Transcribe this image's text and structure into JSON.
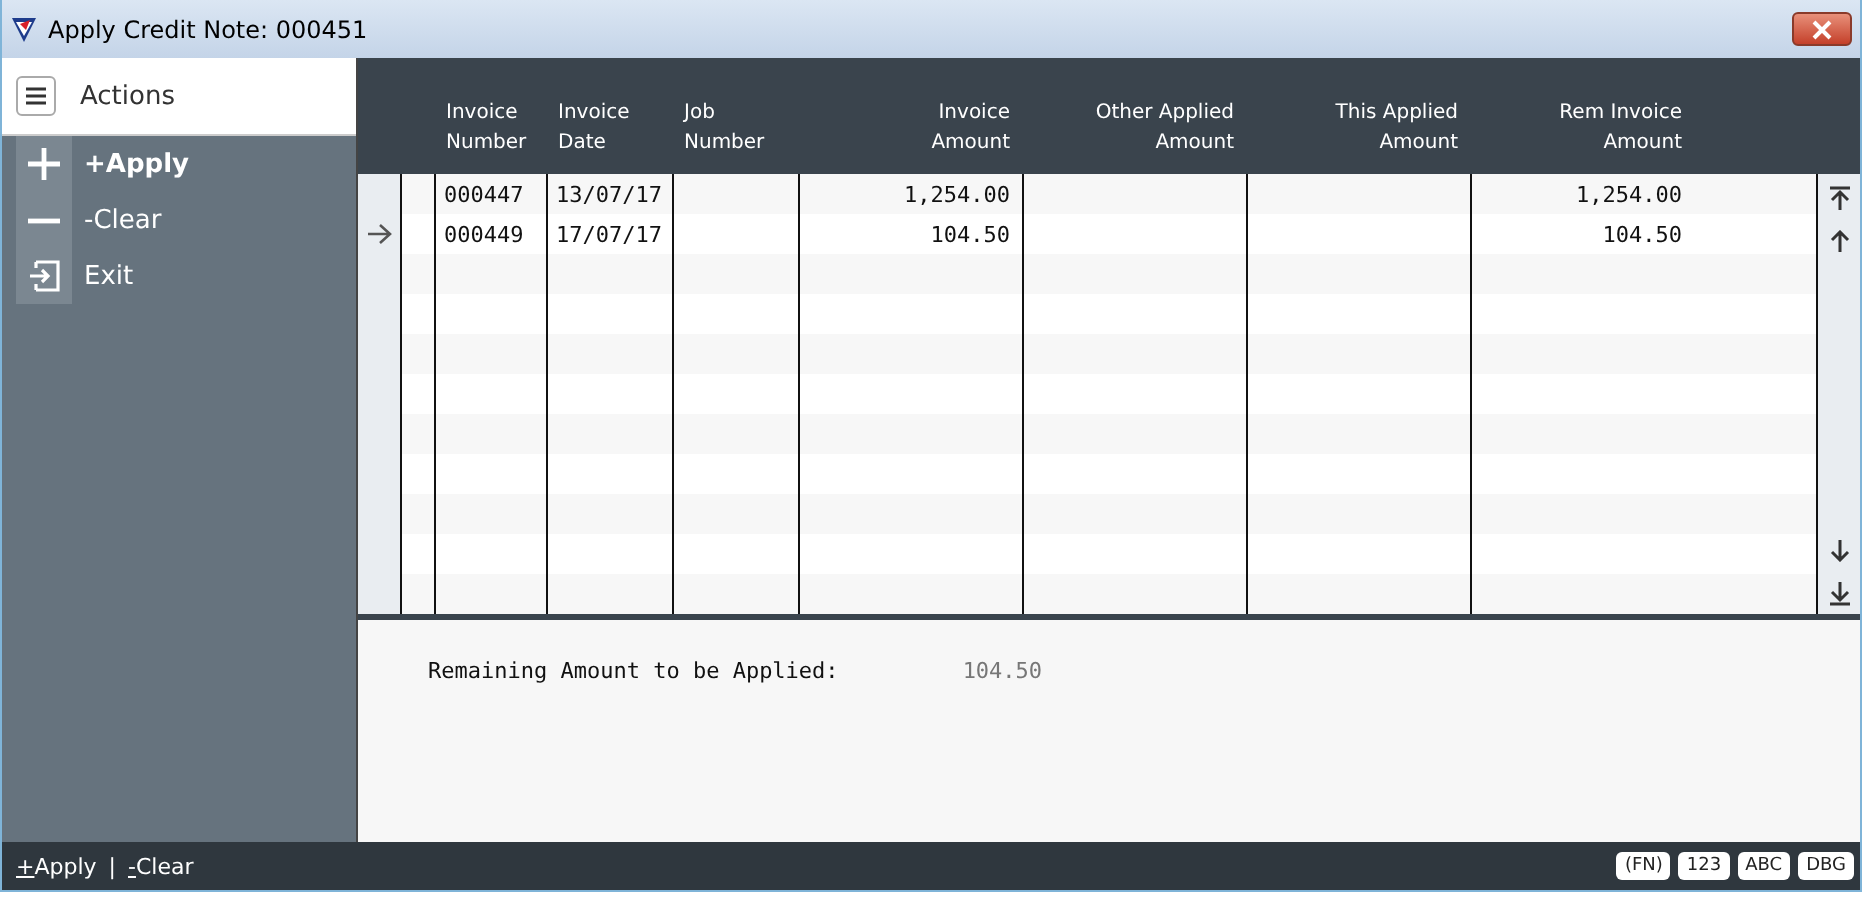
{
  "window": {
    "title": "Apply Credit Note: 000451"
  },
  "sidebar": {
    "title": "Actions",
    "items": [
      {
        "label": "+Apply",
        "selected": true
      },
      {
        "label": "-Clear",
        "selected": false
      },
      {
        "label": "Exit",
        "selected": false
      }
    ]
  },
  "table": {
    "columns": [
      {
        "label": "Invoice\nNumber"
      },
      {
        "label": "Invoice\nDate"
      },
      {
        "label": "Job\nNumber"
      },
      {
        "label": "Invoice\nAmount"
      },
      {
        "label": "Other Applied\nAmount"
      },
      {
        "label": "This Applied\nAmount"
      },
      {
        "label": "Rem Invoice\nAmount"
      }
    ],
    "rows": [
      {
        "current": false,
        "cells": [
          "000447",
          "13/07/17",
          "",
          "1,254.00",
          "",
          "",
          "1,254.00"
        ]
      },
      {
        "current": true,
        "cells": [
          "000449",
          "17/07/17",
          "",
          "104.50",
          "",
          "",
          "104.50"
        ]
      }
    ]
  },
  "summary": {
    "label": "Remaining Amount to be Applied:",
    "value": "104.50"
  },
  "status_bar": {
    "shortcuts": [
      {
        "key": "+",
        "label": "Apply"
      },
      {
        "key": "-",
        "label": "Clear"
      }
    ],
    "separator": "|",
    "badges": [
      "(FN)",
      "123",
      "ABC",
      "DBG"
    ]
  }
}
